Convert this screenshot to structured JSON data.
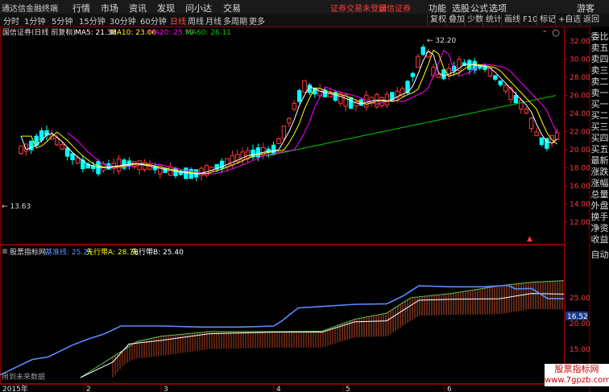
{
  "topbar": {
    "app_title": "通达信金融终端",
    "menu": [
      "行情",
      "市场",
      "资讯",
      "发现",
      "问小达",
      "交易"
    ],
    "warning": "证券交易未登录",
    "broker": "国信证券",
    "right_items": [
      "功能",
      "选股",
      "公式",
      "选项",
      "游客"
    ]
  },
  "toolbar": {
    "periods": [
      "分时",
      "1分钟",
      "5分钟",
      "15分钟",
      "30分钟",
      "60分钟",
      "日线",
      "周线",
      "月线",
      "多周期",
      "更多"
    ],
    "active_period": "日线",
    "right_buttons": [
      "复权",
      "叠加",
      "少数",
      "统计",
      "画线",
      "F10",
      "标记",
      "+自选",
      "返回"
    ]
  },
  "main_chart": {
    "title": "国信证券(日线 前复权)",
    "ma_labels": [
      {
        "text": "MA5: 21.38",
        "color": "#ffffff"
      },
      {
        "text": "MA10: 23.06",
        "color": "#ffff00"
      },
      {
        "text": "MA20: 25.92",
        "color": "#ff00ff"
      },
      {
        "text": "MA60: 26.11",
        "color": "#00cc00"
      }
    ],
    "y_ticks": [
      "32.00",
      "30.00",
      "28.00",
      "26.00",
      "24.00",
      "22.00",
      "20.00",
      "18.00",
      "16.00",
      "14.00",
      "12.00"
    ],
    "high_label": "32.20",
    "low_label": "13.63"
  },
  "indicator": {
    "name": "股票指标网",
    "labels": [
      {
        "text": "基准线: 25.26",
        "color": "#5c8cff"
      },
      {
        "text": "先行带A: 28.78",
        "color": "#ffff00"
      },
      {
        "text": "先行带B: 25.40",
        "color": "#ffffff"
      }
    ],
    "y_ticks": [
      "25.00",
      "20.00",
      "15.00",
      "10.00"
    ],
    "highlight_value": "16.52",
    "footer_note": "用到未来数据"
  },
  "x_axis": {
    "year_label": "2015年",
    "month_labels": [
      "2",
      "3",
      "4",
      "5",
      "6"
    ]
  },
  "sidebar": {
    "top_label": "委比",
    "items": [
      "卖五",
      "卖四",
      "卖三",
      "卖二",
      "卖一",
      "买一",
      "买二",
      "买三",
      "买四",
      "买五",
      "最新",
      "涨跌",
      "涨幅",
      "总量",
      "外盘",
      "换手",
      "净资",
      "收益"
    ],
    "bottom_label": "自动"
  },
  "watermark": {
    "line1": "股票指标网",
    "line2": "www.7gpzb.com"
  },
  "colors": {
    "up": "#ff3b3b",
    "down": "#00ffff",
    "ma5": "#ffffff",
    "ma10": "#ffff00",
    "ma20": "#ff00ff",
    "ma60": "#00cc00",
    "baseline": "#5c8cff"
  }
}
